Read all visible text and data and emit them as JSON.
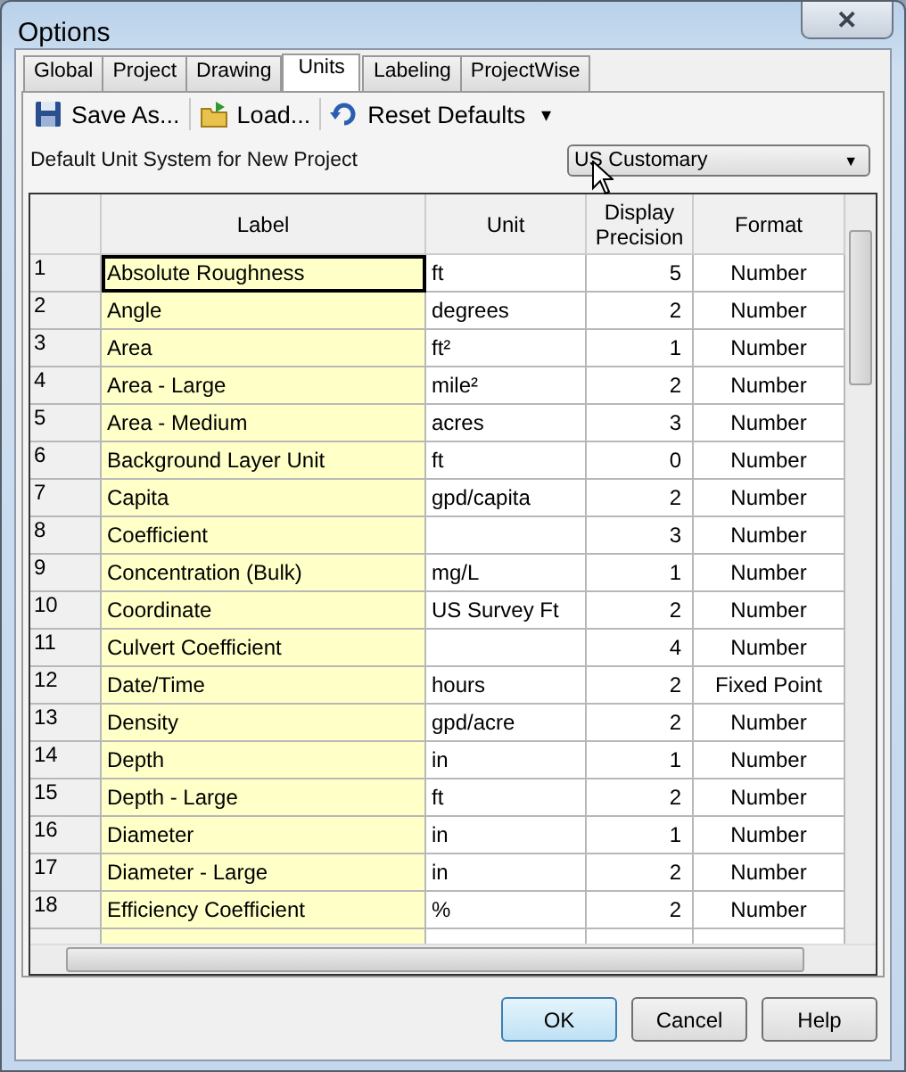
{
  "window": {
    "title": "Options",
    "close": "✕"
  },
  "tabs": [
    {
      "label": "Global",
      "selected": false
    },
    {
      "label": "Project",
      "selected": false
    },
    {
      "label": "Drawing",
      "selected": false
    },
    {
      "label": "Units",
      "selected": true
    },
    {
      "label": "Labeling",
      "selected": false
    },
    {
      "label": "ProjectWise",
      "selected": false
    }
  ],
  "toolbar": [
    {
      "kind": "save",
      "label": "Save As..."
    },
    {
      "kind": "load",
      "label": "Load..."
    },
    {
      "kind": "reset",
      "label": "Reset Defaults",
      "dropdown": "▾"
    }
  ],
  "unit_system": {
    "label": "Default Unit System for New Project",
    "value": "US Customary",
    "arrow": "▼"
  },
  "table": {
    "columns": [
      "Label",
      "Unit",
      "Display Precision",
      "Format"
    ],
    "rows": [
      {
        "number": "1",
        "label": "Absolute Roughness",
        "unit": "ft",
        "precision": "5",
        "format": "Number",
        "selected": true
      },
      {
        "number": "2",
        "label": "Angle",
        "unit": "degrees",
        "precision": "2",
        "format": "Number",
        "selected": false
      },
      {
        "number": "3",
        "label": "Area",
        "unit": "ft²",
        "precision": "1",
        "format": "Number",
        "selected": false
      },
      {
        "number": "4",
        "label": "Area - Large",
        "unit": "mile²",
        "precision": "2",
        "format": "Number",
        "selected": false
      },
      {
        "number": "5",
        "label": "Area - Medium",
        "unit": "acres",
        "precision": "3",
        "format": "Number",
        "selected": false
      },
      {
        "number": "6",
        "label": "Background Layer Unit",
        "unit": "ft",
        "precision": "0",
        "format": "Number",
        "selected": false
      },
      {
        "number": "7",
        "label": "Capita",
        "unit": "gpd/capita",
        "precision": "2",
        "format": "Number",
        "selected": false
      },
      {
        "number": "8",
        "label": "Coefficient",
        "unit": "",
        "precision": "3",
        "format": "Number",
        "selected": false
      },
      {
        "number": "9",
        "label": "Concentration (Bulk)",
        "unit": "mg/L",
        "precision": "1",
        "format": "Number",
        "selected": false
      },
      {
        "number": "10",
        "label": "Coordinate",
        "unit": "US Survey Ft",
        "precision": "2",
        "format": "Number",
        "selected": false
      },
      {
        "number": "11",
        "label": "Culvert Coefficient",
        "unit": "",
        "precision": "4",
        "format": "Number",
        "selected": false
      },
      {
        "number": "12",
        "label": "Date/Time",
        "unit": "hours",
        "precision": "2",
        "format": "Fixed Point",
        "selected": false
      },
      {
        "number": "13",
        "label": "Density",
        "unit": "gpd/acre",
        "precision": "2",
        "format": "Number",
        "selected": false
      },
      {
        "number": "14",
        "label": "Depth",
        "unit": "in",
        "precision": "1",
        "format": "Number",
        "selected": false
      },
      {
        "number": "15",
        "label": "Depth - Large",
        "unit": "ft",
        "precision": "2",
        "format": "Number",
        "selected": false
      },
      {
        "number": "16",
        "label": "Diameter",
        "unit": "in",
        "precision": "1",
        "format": "Number",
        "selected": false
      },
      {
        "number": "17",
        "label": "Diameter - Large",
        "unit": "in",
        "precision": "2",
        "format": "Number",
        "selected": false
      },
      {
        "number": "18",
        "label": "Efficiency Coefficient",
        "unit": "%",
        "precision": "2",
        "format": "Number",
        "selected": false
      }
    ]
  },
  "buttons": [
    {
      "label": "OK",
      "default": true
    },
    {
      "label": "Cancel",
      "default": false
    },
    {
      "label": "Help",
      "default": false
    }
  ]
}
